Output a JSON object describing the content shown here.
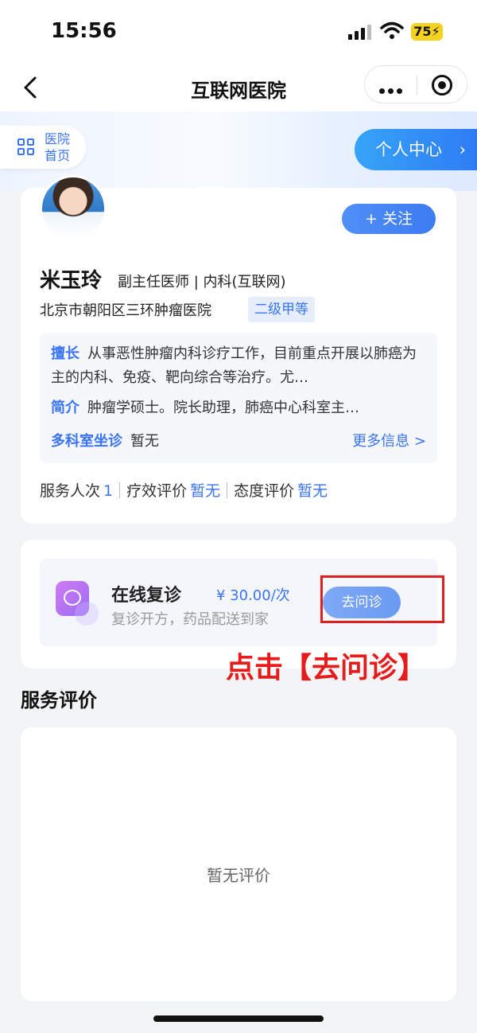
{
  "status_bar": {
    "time": "15:56",
    "battery": "75"
  },
  "nav": {
    "title": "互联网医院"
  },
  "header": {
    "home_label": "医院首页",
    "personal_center": "个人中心"
  },
  "doctor": {
    "follow_button": "+ 关注",
    "name": "米玉玲",
    "title": "副主任医师 | 内科(互联网)",
    "hospital": "北京市朝阳区三环肿瘤医院",
    "hospital_level": "二级甲等",
    "specialty_label": "擅长",
    "specialty": "从事恶性肿瘤内科诊疗工作，目前重点开展以肺癌为主的内科、免疫、靶向综合等治疗。尤…",
    "intro_label": "简介",
    "intro": "肿瘤学硕士。院长助理，肺癌中心科室主…",
    "multi_dept_label": "多科室坐诊",
    "multi_dept_value": "暂无",
    "more_info": "更多信息 >"
  },
  "stats": {
    "served_label": "服务人次",
    "served_value": "1",
    "efficacy_label": "疗效评价",
    "efficacy_value": "暂无",
    "attitude_label": "态度评价",
    "attitude_value": "暂无"
  },
  "service": {
    "name": "在线复诊",
    "price": "¥ 30.00/次",
    "description": "复诊开方，药品配送到家",
    "action_button": "去问诊"
  },
  "annotation": "点击【去问诊】",
  "reviews": {
    "title": "服务评价",
    "empty_text": "暂无评价"
  },
  "colors": {
    "accent": "#3a74f5",
    "annotation_red": "#e61b1b"
  }
}
